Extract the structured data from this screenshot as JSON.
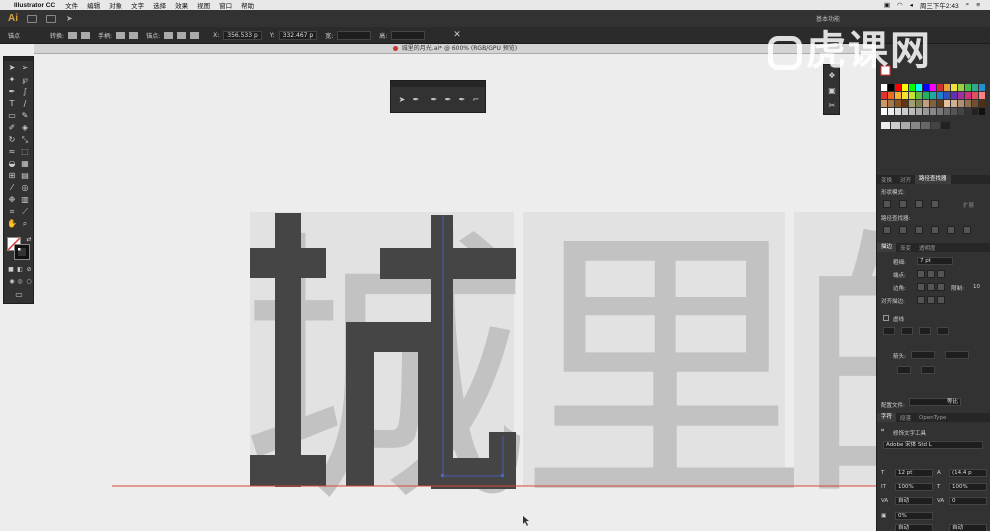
{
  "menubar": {
    "app_name": "Illustrator CC",
    "items": [
      "文件",
      "编辑",
      "对象",
      "文字",
      "选择",
      "效果",
      "视图",
      "窗口",
      "帮助"
    ],
    "clock": "周三下午2:43"
  },
  "appbar": {
    "logo": "Ai",
    "workspace": "基本功能"
  },
  "controlbar": {
    "mode": "锚点",
    "convert_label": "转换:",
    "handles_label": "手柄:",
    "anchors_label": "锚点:",
    "x_label": "X:",
    "x_value": "356.533 p",
    "y_label": "Y:",
    "y_value": "332.467 p",
    "w_label": "宽:",
    "h_label": "高:"
  },
  "document": {
    "tab_title": "城里的月光.ai* @ 600% (RGB/GPU 预览)"
  },
  "canvas": {
    "glyphs": [
      "城",
      "里",
      "的"
    ]
  },
  "right_panel": {
    "tabs_a": [
      "变换",
      "对齐",
      "路径查找器"
    ],
    "pathfinder_shape_modes": "形状模式:",
    "pathfinder_label": "路径查找器:",
    "expand_label": "扩展",
    "tabs_b": [
      "描边",
      "渐变",
      "透明度"
    ],
    "weight_label": "粗细:",
    "weight_value": "7 pt",
    "cap_label": "端点:",
    "corner_label": "边角:",
    "limit_label": "限制:",
    "limit_value": "10",
    "align_label": "对齐描边:",
    "dashed_label": "虚线",
    "arrow_label": "箭头:",
    "profile_label": "配置文件:",
    "profile_value": "等比",
    "tabs_c": [
      "字符",
      "段落",
      "OpenType"
    ],
    "touch_type": "修饰文字工具",
    "font_name": "Adobe 宋体 Std L",
    "font_size": "12 pt",
    "leading": "(14.4 p",
    "scale_h": "100%",
    "scale_v": "100%",
    "tracking_mode": "自动",
    "tracking": "0",
    "baseline": "0%",
    "bottom_a": "自动",
    "bottom_b": "自动"
  },
  "watermark": {
    "text": "虎课网"
  },
  "colors": {
    "glyph_dark": "#454545",
    "glyph_light": "#c2c2c2",
    "artboard": "#e2e2e2",
    "baseline_red": "#d4453a",
    "selection_blue": "#4a63d4"
  }
}
